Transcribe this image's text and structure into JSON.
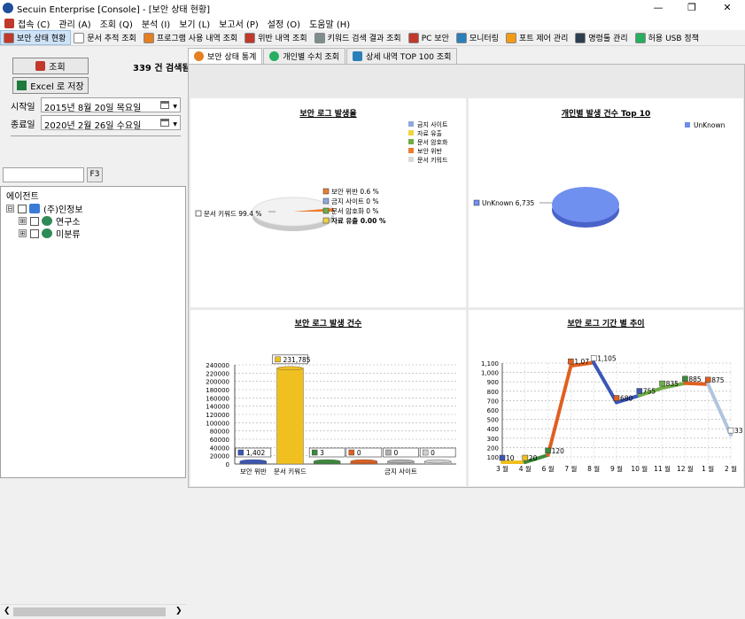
{
  "window": {
    "title": "Secuin Enterprise [Console] - [보안 상태 현황]",
    "min": "—",
    "max": "❐",
    "close": "✕"
  },
  "menu": [
    "접속 (C)",
    "관리 (A)",
    "조회 (Q)",
    "분석 (I)",
    "보기 (L)",
    "보고서 (P)",
    "설정 (O)",
    "도움말 (H)"
  ],
  "mdi_controls": [
    "_",
    "▭",
    "✕"
  ],
  "toolbar": [
    {
      "label": "보안 상태 현황",
      "color": "#c0392b",
      "active": true
    },
    {
      "label": "문서 추적 조회",
      "color": "#ffffff",
      "active": false
    },
    {
      "label": "프로그램 사용 내역 조회",
      "color": "#e67e22",
      "active": false
    },
    {
      "label": "위반 내역 조회",
      "color": "#c0392b",
      "active": false
    },
    {
      "label": "키워드 검색 결과 조회",
      "color": "#7f8c8d",
      "active": false
    },
    {
      "label": "PC 보안",
      "color": "#c0392b",
      "active": false
    },
    {
      "label": "모니터링",
      "color": "#2980b9",
      "active": false
    },
    {
      "label": "포트 제어 관리",
      "color": "#f39c12",
      "active": false
    },
    {
      "label": "명령툴 관리",
      "color": "#2c3e50",
      "active": false
    },
    {
      "label": "허용 USB 정책",
      "color": "#27ae60",
      "active": false
    }
  ],
  "left": {
    "search_button": "조회",
    "result_count": "339 건 검색됨",
    "excel_button": "Excel 로 저장",
    "start_label": "시작일",
    "start_value": "2015년  8월 20일 목요일",
    "end_label": "종료일",
    "end_value": "2020년  2월 26일 수요일",
    "filter_value": "",
    "f3_label": "F3",
    "tree_header": "에이전트",
    "tree": [
      {
        "label": "(주)인정보",
        "expander": "⊟"
      },
      {
        "label": "연구소",
        "expander": "⊞"
      },
      {
        "label": "미분류",
        "expander": "⊞"
      }
    ]
  },
  "tabs": [
    {
      "label": "보안 상태 통계",
      "color": "#e67e22"
    },
    {
      "label": "개인별 수치 조회",
      "color": "#27ae60"
    },
    {
      "label": "상세 내역 TOP 100 조회",
      "color": "#2980b9"
    }
  ],
  "chart_data": [
    {
      "type": "pie",
      "title": "보안 로그 발생율",
      "legend": [
        "금지 사이트",
        "자료 유출",
        "문서 암호화",
        "보안 위반",
        "문서 키워드"
      ],
      "legend_colors": [
        "#8ea9db",
        "#f2d33f",
        "#70ad47",
        "#ed7d31",
        "#d9d9d9"
      ],
      "slices": [
        {
          "label": "보안 위반 0.6 %",
          "value": 0.6
        },
        {
          "label": "금지 사이트 0 %",
          "value": 0
        },
        {
          "label": "문서 암호화 0 %",
          "value": 0
        },
        {
          "label": "자료 유출 0.00 %",
          "value": 0
        },
        {
          "label": "문서 키워드 99.4 %",
          "value": 99.4
        }
      ]
    },
    {
      "type": "pie",
      "title": "개인별 발생 건수 Top 10",
      "legend": [
        "UnKnown"
      ],
      "legend_colors": [
        "#6d8ee8"
      ],
      "slices": [
        {
          "label": "UnKnown 6,735",
          "value": 6735
        }
      ]
    },
    {
      "type": "bar",
      "title": "보안 로그 발생 건수",
      "categories": [
        "보안 위반",
        "문서 키워드",
        "",
        "",
        "금지 사이트",
        ""
      ],
      "values": [
        1402,
        231785,
        3,
        0,
        0,
        0
      ],
      "data_labels": [
        "1,402",
        "231,785",
        "3",
        "0",
        "0",
        "0"
      ],
      "colors": [
        "#3a56b7",
        "#f0c020",
        "#3c8a3c",
        "#e06020",
        "#b0b0b0",
        "#d0d0d0"
      ],
      "y_ticks": [
        "240000",
        "220000",
        "200000",
        "180000",
        "160000",
        "140000",
        "120000",
        "100000",
        "80000",
        "60000",
        "40000",
        "20000",
        "0"
      ],
      "ylim": [
        0,
        240000
      ]
    },
    {
      "type": "line",
      "title": "보안 로그 기간 별 추이",
      "categories": [
        "3 월",
        "4 월",
        "6 월",
        "7 월",
        "8 월",
        "9 월",
        "10 월",
        "11 월",
        "12 월",
        "1 월",
        "2 월"
      ],
      "values": [
        10,
        20,
        120,
        1070,
        1105,
        680,
        755,
        835,
        885,
        875,
        335
      ],
      "data_labels": [
        "10",
        "20",
        "120",
        "1,07",
        "1,105",
        "680",
        "755",
        "835",
        "885",
        "875",
        "335"
      ],
      "y_ticks": [
        "1,100",
        "1,000",
        "900",
        "800",
        "700",
        "600",
        "500",
        "400",
        "300",
        "200",
        "100"
      ],
      "ylim": [
        0,
        1150
      ]
    }
  ]
}
